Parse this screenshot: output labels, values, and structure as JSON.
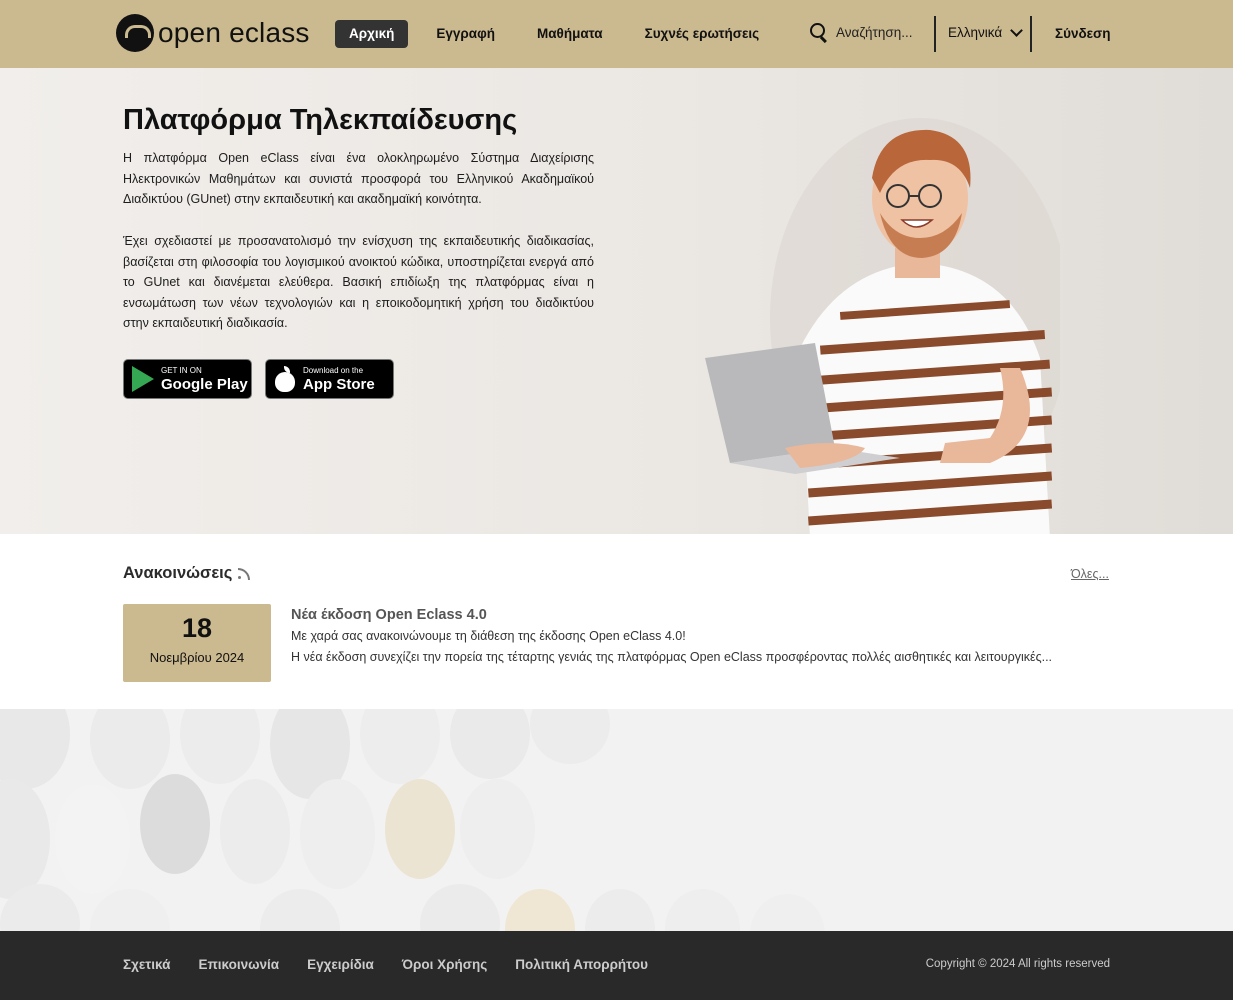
{
  "brand": {
    "logo_text": "open eclass"
  },
  "nav": {
    "items": [
      {
        "label": "Αρχική",
        "active": true
      },
      {
        "label": "Εγγραφή"
      },
      {
        "label": "Μαθήματα"
      },
      {
        "label": "Συχνές ερωτήσεις"
      }
    ],
    "search_placeholder": "Αναζήτηση...",
    "language": "Ελληνικά",
    "login": "Σύνδεση"
  },
  "hero": {
    "title": "Πλατφόρμα Τηλεκπαίδευσης",
    "p1": "Η πλατφόρμα Open eClass είναι ένα ολοκληρωμένο Σύστημα Διαχείρισης Ηλεκτρονικών Μαθημάτων και συνιστά προσφορά του Ελληνικού Ακαδημαϊκού Διαδικτύου (GUnet) στην εκπαιδευτική και ακαδημαϊκή κοινότητα.",
    "p2": "Έχει σχεδιαστεί με προσανατολισμό την ενίσχυση της εκπαιδευτικής διαδικασίας, βασίζεται στη φιλοσοφία του λογισμικού ανοικτού κώδικα, υποστηρίζεται ενεργά από το GUnet και διανέμεται ελεύθερα. Βασική επιδίωξη της πλατφόρμας είναι η ενσωμάτωση των νέων τεχνολογιών και η εποικοδομητική χρήση του διαδικτύου στην εκπαιδευτική διαδικασία.",
    "google_play_small": "GET IN ON",
    "google_play_big": "Google Play",
    "app_store_small": "Download on the",
    "app_store_big": "App Store"
  },
  "announcements": {
    "title": "Ανακοινώσεις",
    "all_link": "Όλες...",
    "items": [
      {
        "day": "18",
        "month_year": "Νοεμβρίου 2024",
        "heading": "Νέα έκδοση Open Eclass 4.0",
        "line1": "Με χαρά σας ανακοινώνουμε τη διάθεση της έκδοσης Open eClass 4.0!",
        "line2": "Η νέα έκδοση συνεχίζει την πορεία της τέταρτης γενιάς της πλατφόρμας Open eClass προσφέροντας πολλές αισθητικές και λειτουργικές..."
      }
    ]
  },
  "footer": {
    "links": [
      "Σχετικά",
      "Επικοινωνία",
      "Εγχειρίδια",
      "Όροι Χρήσης",
      "Πολιτική Απορρήτου"
    ],
    "copyright": "Copyright © 2024 All rights reserved"
  },
  "colors": {
    "brand_tan": "#cbb98f",
    "footer_dark": "#292929",
    "active_nav": "#333333"
  },
  "icons": [
    "search-icon",
    "chevron-down-icon",
    "rss-icon",
    "google-play-icon",
    "apple-icon"
  ]
}
